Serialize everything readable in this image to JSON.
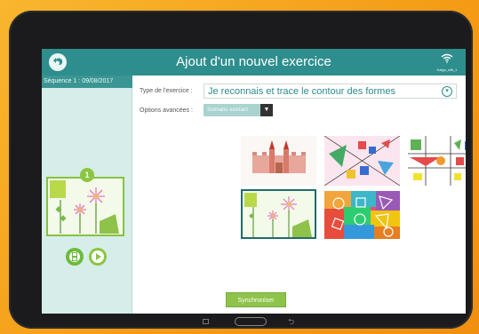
{
  "header": {
    "title": "Ajout d'un nouvel exercice",
    "wifi_label": "Kalgo_wifi_1",
    "back_icon": "back-arrow-icon",
    "wifi_icon": "wifi-icon"
  },
  "sidebar": {
    "sequence_label": "Séquence 1 : 09/08/2017",
    "badge_count": "1",
    "film_icon": "film-reel-icon",
    "play_icon": "play-icon"
  },
  "form": {
    "type_label": "Type de l'exercice :",
    "type_value": "Je reconnais et trace le contour des formes",
    "advanced_label": "Options avancées :",
    "scenario_value": "Scénario existant"
  },
  "exercises": [
    {
      "name": "castle-exercise",
      "selected": false
    },
    {
      "name": "colored-shapes-exercise",
      "selected": false
    },
    {
      "name": "lines-shapes-exercise",
      "selected": false
    },
    {
      "name": "flowers-exercise",
      "selected": true
    },
    {
      "name": "mosaic-shapes-exercise",
      "selected": false
    }
  ],
  "actions": {
    "sync_label": "Synchroniser"
  },
  "colors": {
    "topbar": "#2e8e8d",
    "sidebar": "#d6ede9",
    "accent_green": "#8dc34a",
    "frame_orange": "#f49a14"
  }
}
